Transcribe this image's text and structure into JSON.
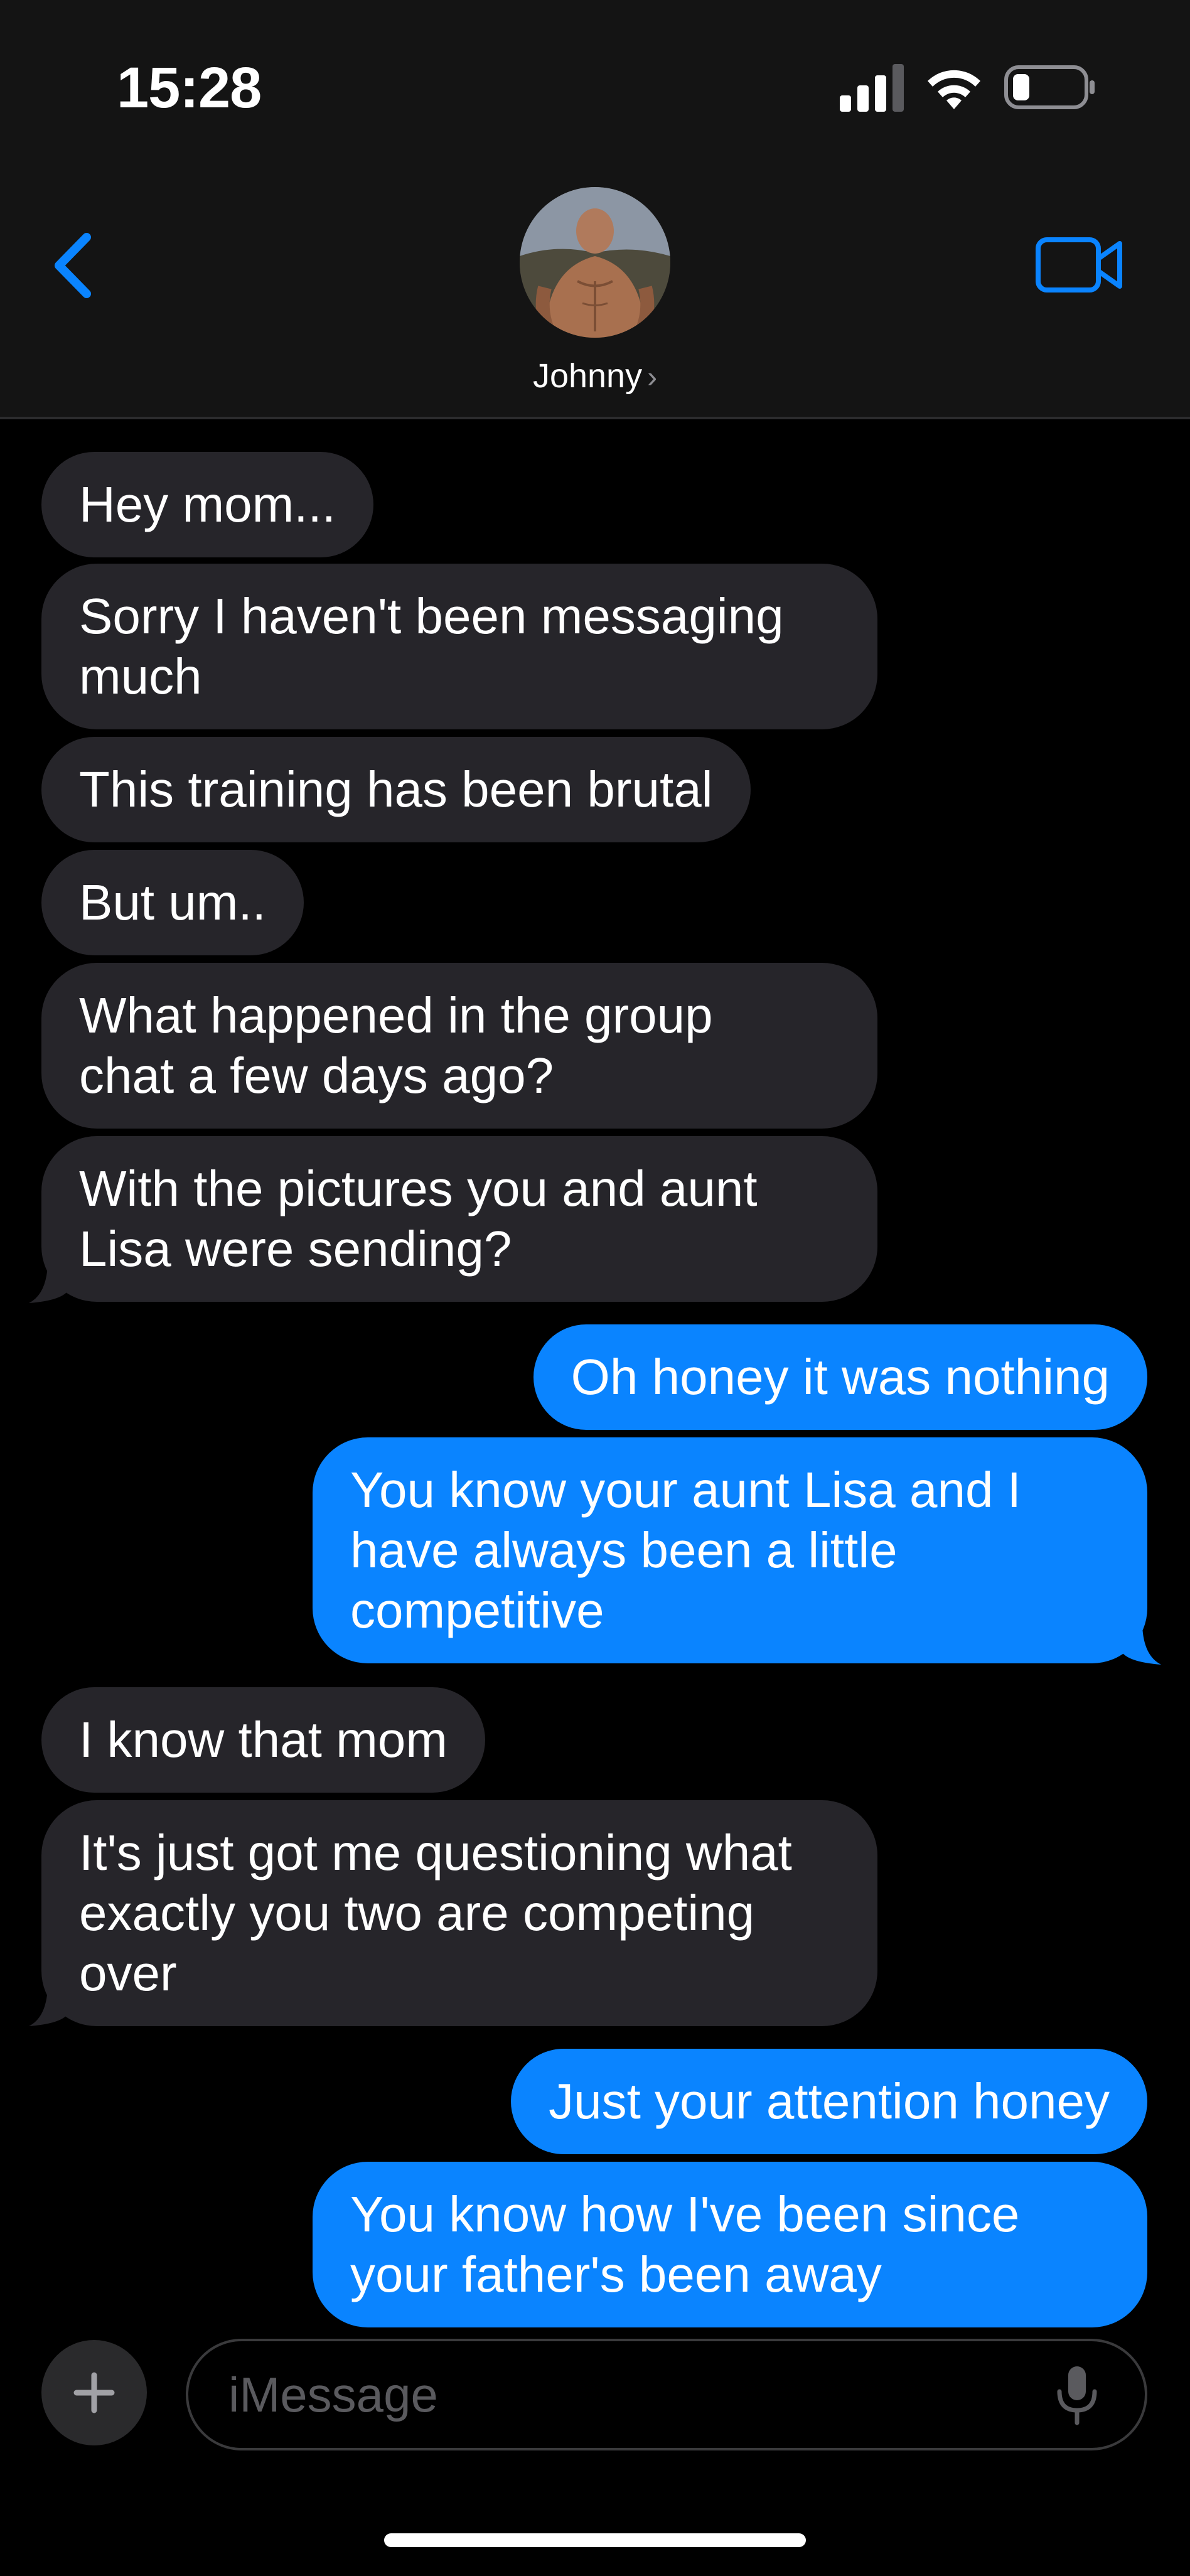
{
  "status_bar": {
    "time": "15:28"
  },
  "contact": {
    "name": "Johnny",
    "chevron": "›"
  },
  "icons": {
    "back": "chevron-left-icon",
    "video": "video-camera-icon",
    "plus": "plus-icon",
    "mic": "microphone-icon"
  },
  "colors": {
    "accent": "#0a84ff",
    "received_bubble": "#26252a",
    "header_bg": "#141414",
    "background": "#000000"
  },
  "messages": [
    {
      "from": "contact",
      "text": "Hey mom..."
    },
    {
      "from": "contact",
      "text": "Sorry I haven't been messaging\nmuch"
    },
    {
      "from": "contact",
      "text": "This training has been brutal"
    },
    {
      "from": "contact",
      "text": "But um.."
    },
    {
      "from": "contact",
      "text": "What happened in the group\nchat a few days ago?"
    },
    {
      "from": "contact",
      "text": "With the pictures you and aunt\nLisa were sending?"
    },
    {
      "from": "me",
      "text": "Oh honey it was nothing"
    },
    {
      "from": "me",
      "text": "You know your aunt Lisa and I\nhave always been a little\ncompetitive"
    },
    {
      "from": "contact",
      "text": "I know that mom"
    },
    {
      "from": "contact",
      "text": "It's just got me questioning what\nexactly you two are competing\nover"
    },
    {
      "from": "me",
      "text": "Just your attention honey"
    },
    {
      "from": "me",
      "text": "You know how I've been since\nyour father's been away"
    }
  ],
  "composer": {
    "placeholder": "iMessage"
  }
}
